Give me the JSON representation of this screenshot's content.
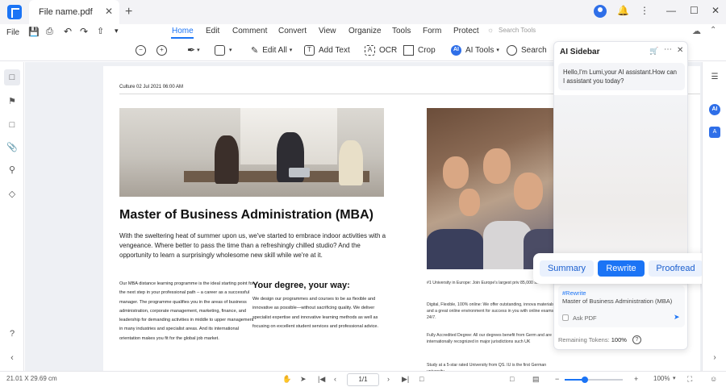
{
  "titlebar": {
    "file_tab": "File name.pdf",
    "close_glyph": "✕",
    "add_glyph": "+",
    "window_controls": [
      "—",
      "☐",
      "✕"
    ]
  },
  "menu": {
    "file": "File",
    "tabs": [
      "Home",
      "Edit",
      "Comment",
      "Convert",
      "View",
      "Organize",
      "Tools",
      "Form",
      "Protect"
    ],
    "active_tab": "Home",
    "search_placeholder": "Search Tools"
  },
  "ribbon": {
    "edit_all": "Edit All",
    "add_text": "Add Text",
    "ocr": "OCR",
    "crop": "Crop",
    "ai_tools": "AI Tools",
    "search": "Search"
  },
  "document": {
    "dateline": "Culture 02 Jul 2021 06:00 AM",
    "headline": "Master of Business Administration (MBA)",
    "intro": "With the sweltering heat of summer upon us, we've started to embrace indoor activities with a vengeance. Where better to pass the time than a refreshingly chilled studio? And the opportunity to learn a surprisingly wholesome new skill while we're at it.",
    "col1": "Our MBA distance learning programme is the ideal starting point for the next step in your professional path – a career as a successful manager. The programme qualifies you in the areas of business administration, corporate management, marketing, finance, and leadership for demanding activities in middle to upper management in many industries and specialist areas. And its international orientation makes you fit for the global job market.",
    "subhead": "Your degree, your way:",
    "col2": "We design our programmes and courses to be as flexible and innovative as possible—without sacrificing quality. We deliver specialist expertise and innovative learning methods as well as focusing on excellent student services and professional advice.",
    "right_p1": "#1 University in Europe: Join Europe's largest priv 85,000 students",
    "right_p2": "Digital, Flexible, 100% online: We offer outstanding, innova materials and a great online environment for success in you with online exams 24/7.",
    "right_p3": "Fully Accredited Degree: All our degrees benefit from Germ and are internationally recognized in major jurisdictions such UK",
    "right_p4": "Study at a 5-star rated University from QS. IU is the first German university"
  },
  "ai_sidebar": {
    "title": "AI Sidebar",
    "greeting": "Hello,I'm Lumi,your AI assistant.How can I assistant you today?",
    "tag": "#Rewrite",
    "input_value": "Master of Business Administration (MBA)",
    "ask_pdf": "Ask PDF",
    "tokens_label": "Remaining Tokens:",
    "tokens_value": "100%",
    "help_glyph": "?"
  },
  "float_actions": {
    "summary": "Summary",
    "rewrite": "Rewrite",
    "proofread": "Proofread"
  },
  "statusbar": {
    "page_size": "21.01 X 29.69 cm",
    "page_indicator": "1/1",
    "zoom": "100%",
    "zoom_fraction": 0.35
  },
  "colors": {
    "accent": "#1b74f5",
    "ai_blue": "#2f6fe8"
  }
}
